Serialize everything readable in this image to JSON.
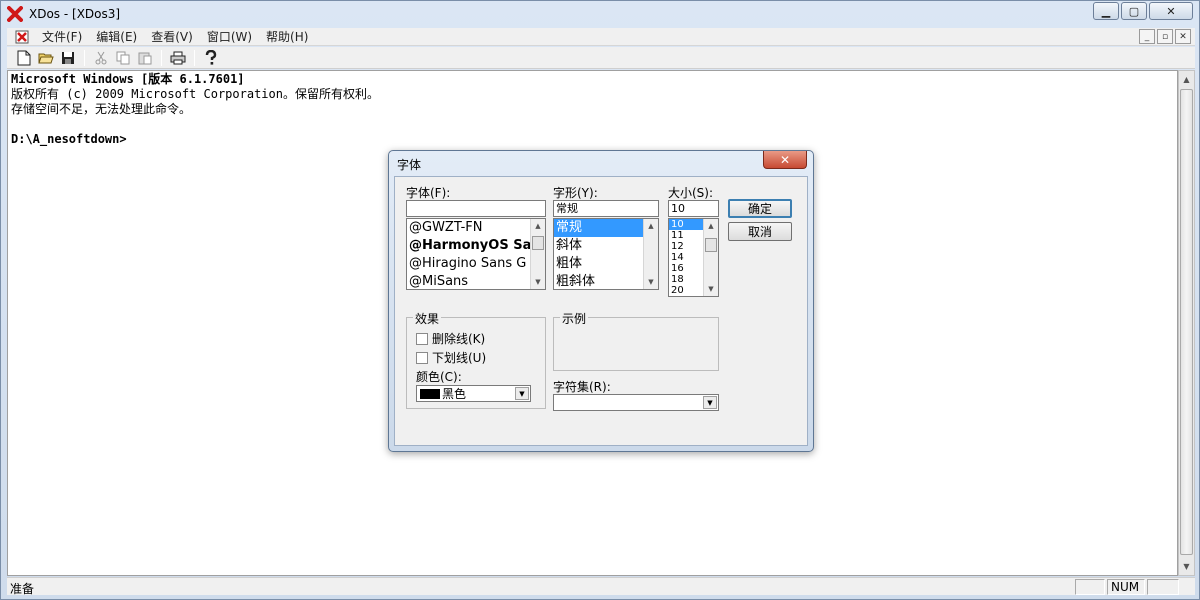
{
  "window": {
    "title": "XDos - [XDos3]",
    "controls": {
      "minimize": "▁",
      "maximize": "▢",
      "close": "✕"
    }
  },
  "menubar": {
    "items": [
      "文件(F)",
      "编辑(E)",
      "查看(V)",
      "窗口(W)",
      "帮助(H)"
    ],
    "mdi": {
      "minimize": "_",
      "restore": "▫",
      "close": "✕"
    }
  },
  "toolbar": {
    "buttons": [
      "new-file",
      "open-folder",
      "save",
      "cut",
      "copy",
      "paste",
      "print",
      "help"
    ]
  },
  "console": {
    "lines": [
      "Microsoft Windows [版本 6.1.7601]",
      "版权所有 (c) 2009 Microsoft Corporation。保留所有权利。",
      "存储空间不足，无法处理此命令。",
      "",
      "D:\\A_nesoftdown>"
    ]
  },
  "statusbar": {
    "text": "准备",
    "panes": [
      "",
      "NUM",
      ""
    ]
  },
  "font_dialog": {
    "title": "字体",
    "close_label": "✕",
    "font_label": "字体(F):",
    "font_value": "",
    "font_list": [
      {
        "label": "@GWZT-FN",
        "bold": false
      },
      {
        "label": "@HarmonyOS Sans",
        "bold": true
      },
      {
        "label": "@Hiragino Sans G",
        "bold": false
      },
      {
        "label": "@MiSans",
        "bold": false
      }
    ],
    "style_label": "字形(Y):",
    "style_value": "常规",
    "style_list": [
      "常规",
      "斜体",
      "粗体",
      "粗斜体"
    ],
    "style_selected": 0,
    "size_label": "大小(S):",
    "size_value": "10",
    "size_list": [
      "10",
      "11",
      "12",
      "14",
      "16",
      "18",
      "20"
    ],
    "size_selected": 0,
    "ok_label": "确定",
    "cancel_label": "取消",
    "effects_label": "效果",
    "strikeout_label": "删除线(K)",
    "underline_label": "下划线(U)",
    "color_label": "颜色(C):",
    "color_value": "黑色",
    "color_swatch": "#000000",
    "sample_label": "示例",
    "charset_label": "字符集(R):",
    "charset_value": ""
  }
}
